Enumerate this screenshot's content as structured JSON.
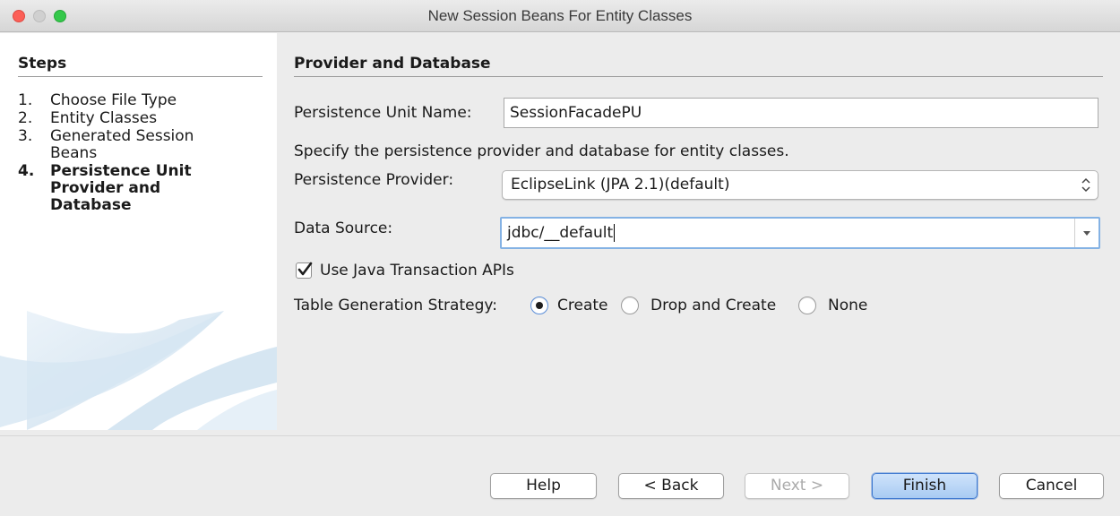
{
  "window": {
    "title": "New Session Beans For Entity Classes"
  },
  "steps": {
    "heading": "Steps",
    "items": [
      {
        "num": "1.",
        "label": "Choose File Type"
      },
      {
        "num": "2.",
        "label": "Entity Classes"
      },
      {
        "num": "3.",
        "label": "Generated Session Beans"
      },
      {
        "num": "4.",
        "label": "Persistence Unit Provider and Database"
      }
    ]
  },
  "main": {
    "heading": "Provider and Database",
    "unit_name_label": "Persistence Unit Name:",
    "unit_name_value": "SessionFacadePU",
    "instruction": "Specify the persistence provider and database for entity classes.",
    "provider_label": "Persistence Provider:",
    "provider_value": "EclipseLink (JPA 2.1)(default)",
    "datasource_label": "Data Source:",
    "datasource_value": "jdbc/__default",
    "jta_label": "Use Java Transaction APIs",
    "jta_checked": true,
    "strategy_label": "Table Generation Strategy:",
    "strategy_options": [
      "Create",
      "Drop and Create",
      "None"
    ],
    "strategy_selected": "Create"
  },
  "buttons": {
    "help": "Help",
    "back": "< Back",
    "next": "Next >",
    "finish": "Finish",
    "cancel": "Cancel"
  },
  "colors": {
    "accent": "#3f79cf",
    "close": "#fc5f57",
    "maximize": "#34c84a"
  }
}
